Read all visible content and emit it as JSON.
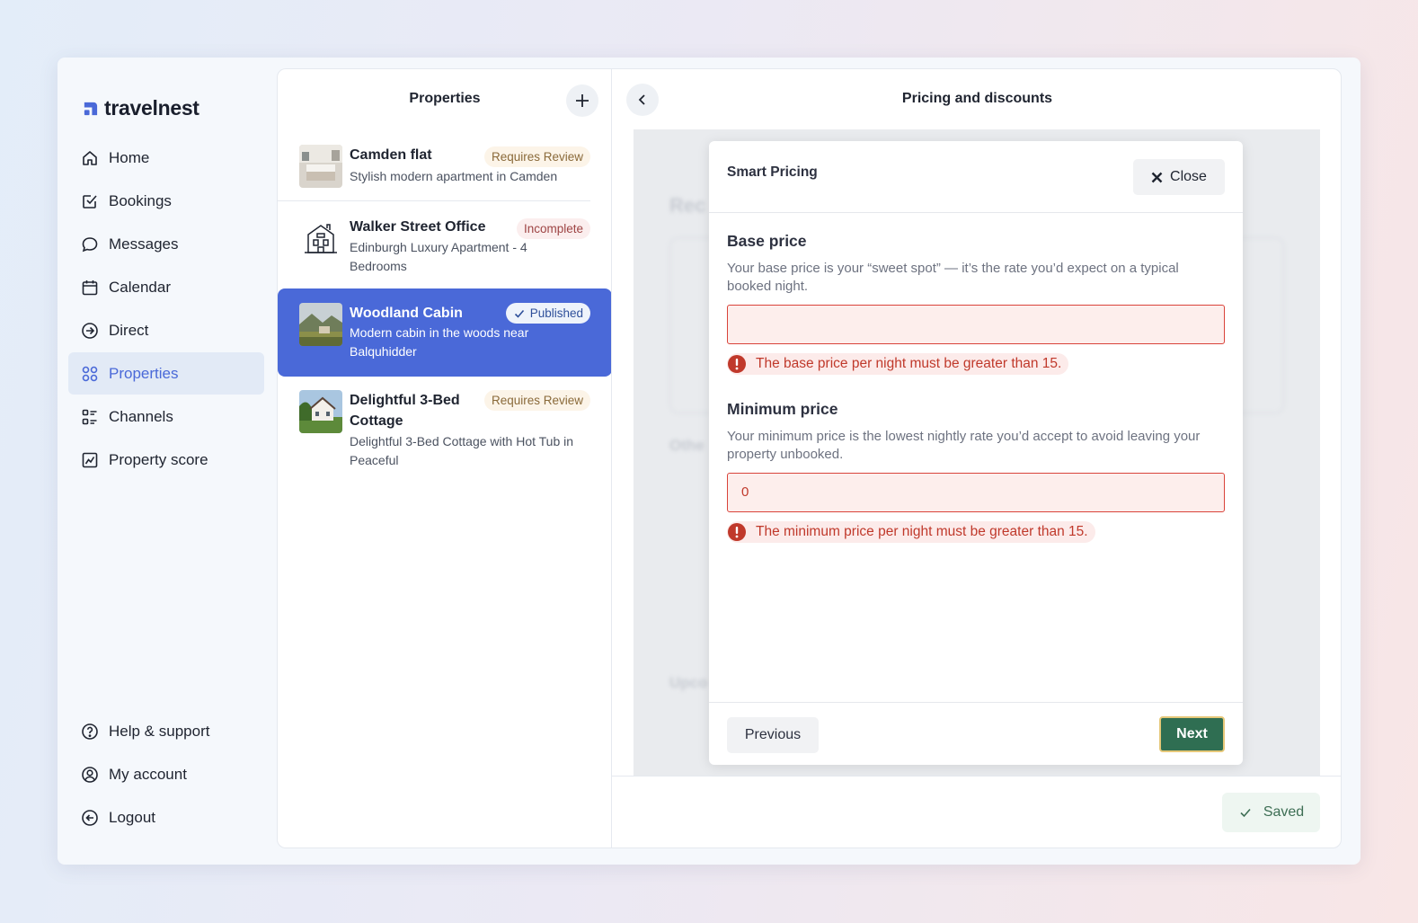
{
  "brand": {
    "name": "travelnest",
    "color": "#4a69d8"
  },
  "nav": {
    "items": [
      {
        "label": "Home",
        "icon": "home-icon"
      },
      {
        "label": "Bookings",
        "icon": "bookings-check-icon"
      },
      {
        "label": "Messages",
        "icon": "message-bubble-icon"
      },
      {
        "label": "Calendar",
        "icon": "calendar-icon"
      },
      {
        "label": "Direct",
        "icon": "direct-arrow-icon"
      },
      {
        "label": "Properties",
        "icon": "grid-icon",
        "active": true
      },
      {
        "label": "Channels",
        "icon": "channels-list-icon"
      },
      {
        "label": "Property score",
        "icon": "chart-icon"
      }
    ],
    "bottom": [
      {
        "label": "Help & support",
        "icon": "help-icon"
      },
      {
        "label": "My account",
        "icon": "account-icon"
      },
      {
        "label": "Logout",
        "icon": "logout-icon"
      }
    ]
  },
  "properties": {
    "title": "Properties",
    "items": [
      {
        "name": "Camden flat",
        "status": "Requires Review",
        "description": "Stylish modern apartment in Camden"
      },
      {
        "name": "Walker Street Office",
        "status": "Incomplete",
        "description": "Edinburgh Luxury Apartment - 4 Bedrooms"
      },
      {
        "name": "Woodland Cabin",
        "status": "Published",
        "description": "Modern cabin in the woods near Balquhidder",
        "selected": true
      },
      {
        "name": "Delightful 3-Bed Cottage",
        "status": "Requires Review",
        "description": "Delightful 3-Bed Cottage with Hot Tub in Peaceful"
      }
    ]
  },
  "main": {
    "title": "Pricing and discounts",
    "saved_label": "Saved"
  },
  "modal": {
    "title": "Smart Pricing",
    "close_label": "Close",
    "base": {
      "label": "Base price",
      "help": "Your base price is your “sweet spot” — it’s the rate you’d expect on a typical booked night.",
      "value": "",
      "error": "The base price per night must be greater than 15."
    },
    "minimum": {
      "label": "Minimum price",
      "help": "Your minimum price is the lowest nightly rate you’d accept to avoid leaving your property unbooked.",
      "value": "0",
      "error": "The minimum price per night must be greater than 15."
    },
    "previous_label": "Previous",
    "next_label": "Next"
  },
  "colors": {
    "error": "#c0392b",
    "primary_green": "#2f6e52",
    "selected_blue": "#4a69d8"
  }
}
